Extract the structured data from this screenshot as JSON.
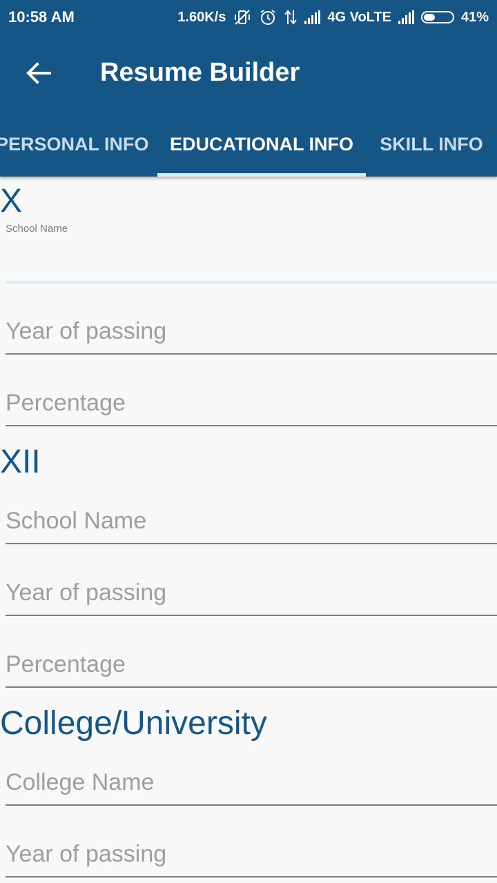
{
  "status_bar": {
    "time": "10:58 AM",
    "speed": "1.60K/s",
    "network": "4G VoLTE",
    "battery": "41%",
    "battery_level": 0.41
  },
  "app_bar": {
    "title": "Resume Builder",
    "back_icon": "arrow-left-icon"
  },
  "tabs": [
    {
      "label": "PERSONAL INFO",
      "active": false
    },
    {
      "label": "EDUCATIONAL INFO",
      "active": true
    },
    {
      "label": "SKILL INFO",
      "active": false
    }
  ],
  "sections": {
    "x": {
      "heading": "X",
      "school_label": "School Name",
      "school_value": "",
      "year_placeholder": "Year of passing",
      "percentage_placeholder": "Percentage"
    },
    "xii": {
      "heading": "XII",
      "school_placeholder": "School Name",
      "year_placeholder": "Year of passing",
      "percentage_placeholder": "Percentage"
    },
    "college": {
      "heading": "College/University",
      "college_placeholder": "College Name",
      "year_placeholder": "Year of passing"
    }
  },
  "colors": {
    "primary": "#155687",
    "accent_light": "#d7ecfa",
    "background": "#f8f8f8",
    "hint_text": "#9e9e9e"
  }
}
